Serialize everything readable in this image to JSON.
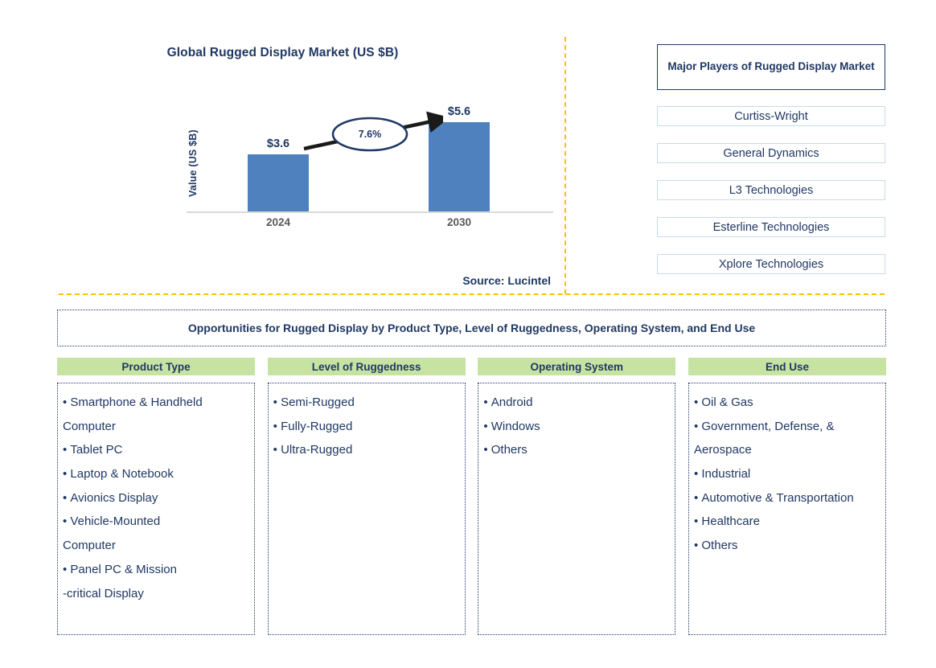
{
  "colors": {
    "navy": "#1f3864",
    "bar_blue": "#4e81bd",
    "divider_yellow": "#ffc000",
    "header_green": "#c7e3a2",
    "player_border": "#c6dbe8",
    "axis_grey": "#d9d9d9",
    "tick_grey": "#595959"
  },
  "chart_panel": {
    "title": "Global Rugged Display Market (US $B)",
    "source": "Source: Lucintel",
    "cagr_label": "7.6%"
  },
  "chart_data": {
    "type": "bar",
    "title": "Global Rugged Display Market (US $B)",
    "xlabel": "",
    "ylabel": "Value (US $B)",
    "categories": [
      "2024",
      "2030"
    ],
    "values": [
      3.6,
      5.6
    ],
    "data_labels": [
      "$3.6",
      "$5.6"
    ],
    "tick_labels": [
      "2024",
      "2030"
    ],
    "ylim": [
      0,
      7.2
    ],
    "grid": false,
    "legend": "none",
    "annotations": [
      {
        "text": "7.6%",
        "type": "cagr-arrow-ellipse",
        "from": "2024",
        "to": "2030"
      }
    ],
    "source": "Source: Lucintel"
  },
  "players_panel": {
    "title": "Major Players of Rugged Display Market",
    "items": [
      "Curtiss-Wright",
      "General Dynamics",
      "L3 Technologies",
      "Esterline Technologies",
      "Xplore Technologies"
    ]
  },
  "opportunities": {
    "title": "Opportunities for Rugged Display by Product Type, Level of Ruggedness, Operating System, and End Use",
    "columns": [
      {
        "header": "Product Type",
        "items": [
          {
            "text": "Smartphone & Handheld",
            "bullet": true
          },
          {
            "text": "Computer",
            "bullet": false
          },
          {
            "text": "Tablet PC",
            "bullet": true
          },
          {
            "text": "Laptop & Notebook",
            "bullet": true
          },
          {
            "text": "Avionics Display",
            "bullet": true
          },
          {
            "text": "Vehicle-Mounted",
            "bullet": true
          },
          {
            "text": "Computer",
            "bullet": false
          },
          {
            "text": "Panel PC & Mission",
            "bullet": true
          },
          {
            "text": "-critical Display",
            "bullet": false
          }
        ]
      },
      {
        "header": "Level of Ruggedness",
        "items": [
          {
            "text": "Semi-Rugged",
            "bullet": true
          },
          {
            "text": "Fully-Rugged",
            "bullet": true
          },
          {
            "text": "Ultra-Rugged",
            "bullet": true
          }
        ]
      },
      {
        "header": "Operating System",
        "items": [
          {
            "text": "Android",
            "bullet": true
          },
          {
            "text": "Windows",
            "bullet": true
          },
          {
            "text": "Others",
            "bullet": true
          }
        ]
      },
      {
        "header": "End Use",
        "items": [
          {
            "text": "Oil & Gas",
            "bullet": true
          },
          {
            "text": "Government, Defense, &",
            "bullet": true
          },
          {
            "text": " Aerospace",
            "bullet": false
          },
          {
            "text": "Industrial",
            "bullet": true
          },
          {
            "text": "Automotive & Transportation",
            "bullet": true
          },
          {
            "text": "Healthcare",
            "bullet": true
          },
          {
            "text": "Others",
            "bullet": true
          }
        ]
      }
    ]
  }
}
